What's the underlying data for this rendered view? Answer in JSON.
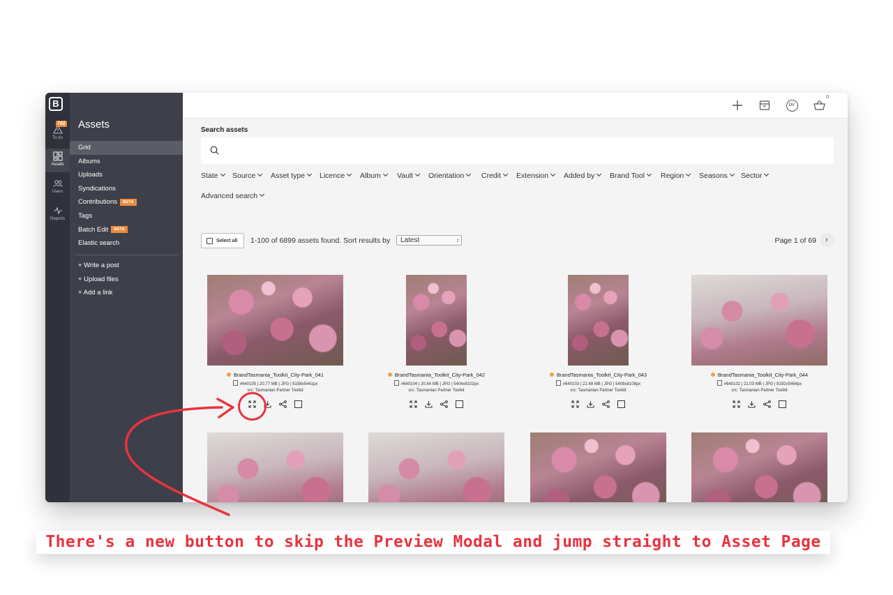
{
  "rail": {
    "logo": "B",
    "todo_badge": "782",
    "todo_label": "To do",
    "assets_label": "Assets",
    "users_label": "Users",
    "reports_label": "Reports"
  },
  "sidebar": {
    "title": "Assets",
    "items": [
      {
        "label": "Grid"
      },
      {
        "label": "Albums"
      },
      {
        "label": "Uploads"
      },
      {
        "label": "Syndications"
      },
      {
        "label": "Contributions",
        "badge": "BETA"
      },
      {
        "label": "Tags"
      },
      {
        "label": "Batch Edit",
        "badge": "BETA"
      },
      {
        "label": "Elastic search"
      }
    ],
    "actions": [
      {
        "label": "+ Write a post"
      },
      {
        "label": "+ Upload files"
      },
      {
        "label": "+ Add a link"
      }
    ]
  },
  "topbar": {
    "avatar_initials": "DV",
    "cart_count": "0"
  },
  "search": {
    "title": "Search assets",
    "placeholder": ""
  },
  "filters": [
    "State",
    "Source",
    "Asset type",
    "Licence",
    "Album",
    "Vault",
    "Orientation",
    "Credit",
    "Extension",
    "Added by",
    "Brand Tool",
    "Region",
    "Seasons",
    "Sector",
    "Advanced search"
  ],
  "results": {
    "select_all": "Select all",
    "summary": "1-100 of 6899 assets found. Sort results by",
    "sort_value": "Latest",
    "page": "Page 1 of 69",
    "next": "›"
  },
  "assets": [
    {
      "name": "BrandTasmania_Toolkit_City-Park_041",
      "meta": "#640105 | 20.77 MB | JPG | 8158x5441px",
      "src": "src: Tasmanian Partner Toolkit"
    },
    {
      "name": "BrandTasmania_Toolkit_City-Park_042",
      "meta": "#640104 | 20.84 MB | JPG | 5404x8102px",
      "src": "src: Tasmanian Partner Toolkit"
    },
    {
      "name": "BrandTasmania_Toolkit_City-Park_043",
      "meta": "#640103 | 22.48 MB | JPG | 5408x8108px",
      "src": "src: Tasmanian Partner Toolkit"
    },
    {
      "name": "BrandTasmania_Toolkit_City-Park_044",
      "meta": "#640102 | 21.03 MB | JPG | 8192x5464px",
      "src": "src: Tasmanian Partner Toolkit"
    }
  ],
  "colors": {
    "accent": "#ee8a3c",
    "annotation": "#e8333f",
    "sidebar": "#3d404a",
    "rail": "#2f323a"
  },
  "caption": "There's a new button to skip the Preview Modal and jump straight to Asset Page"
}
